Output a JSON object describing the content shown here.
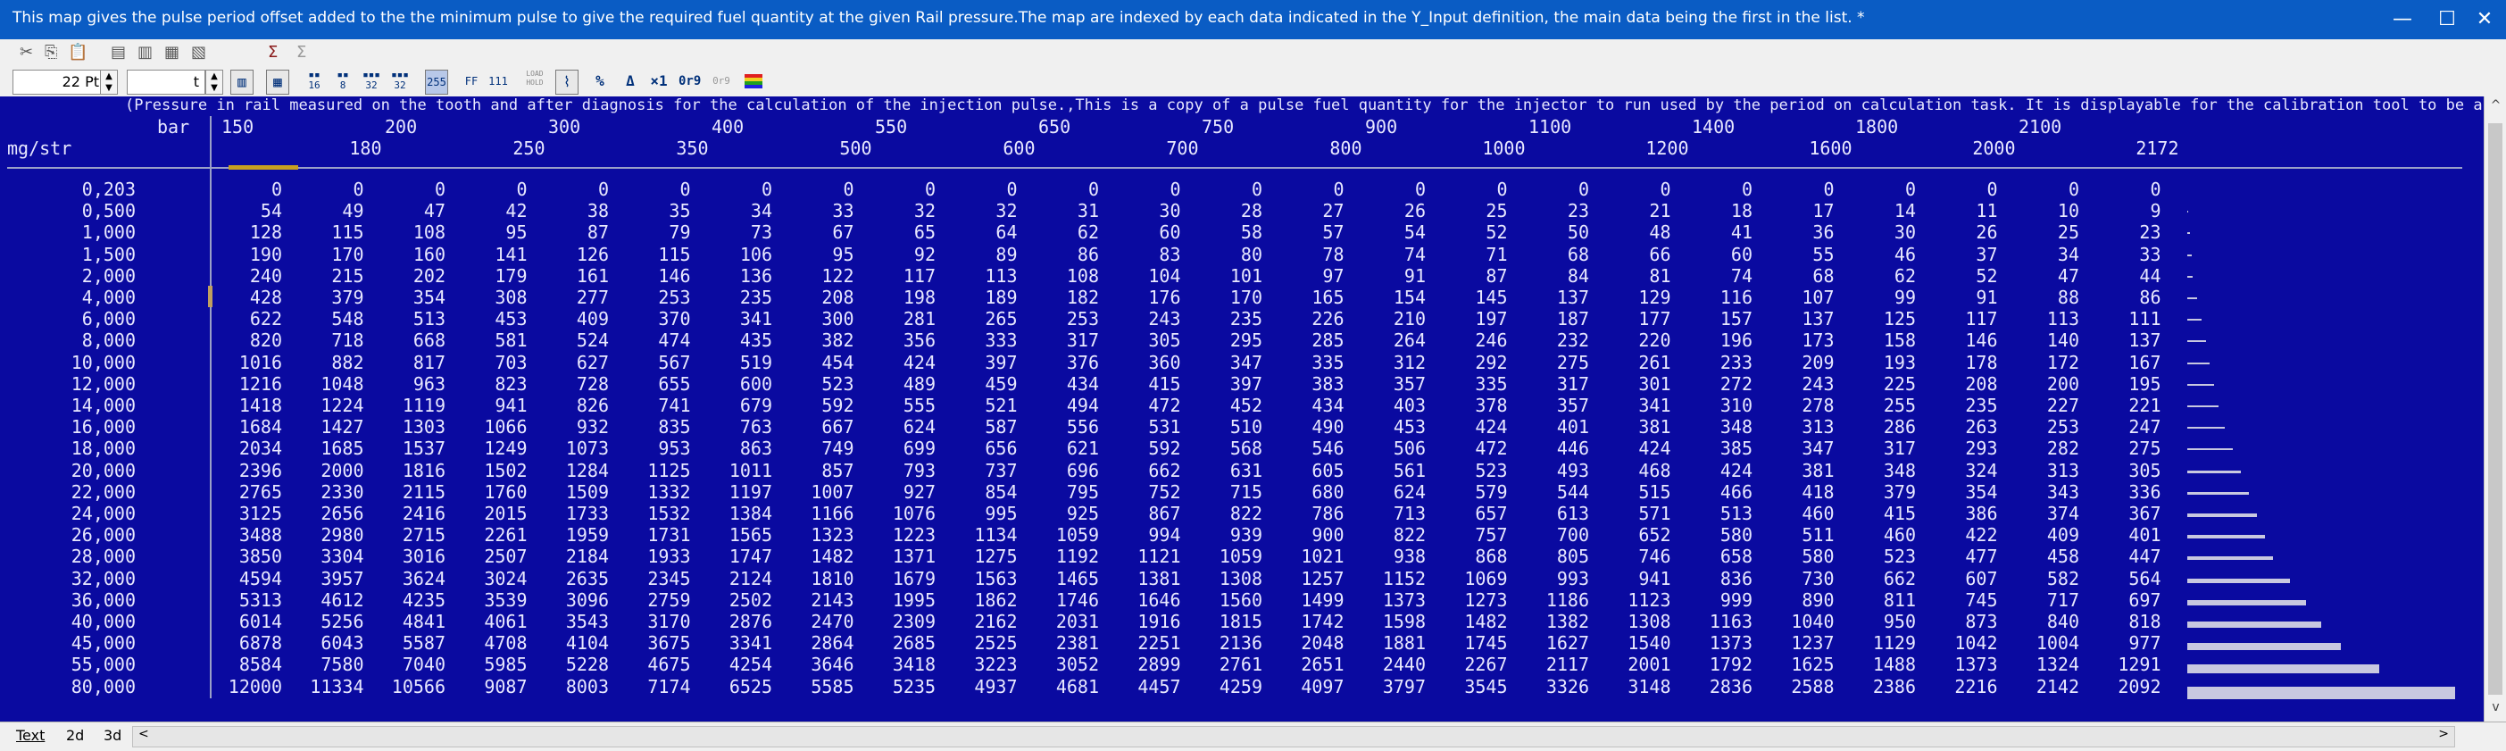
{
  "window": {
    "title": "This map gives the pulse period offset added to the the minimum pulse to give the required fuel quantity at the given Rail pressure.The map are indexed by each data indicated in the Y_Input definition, the main data being the first in the list. *",
    "minimize": "—",
    "maximize": "☐",
    "close": "✕"
  },
  "toolbar": {
    "font_size": "22 Pt",
    "t_field": "t"
  },
  "toolbar2_labels": {
    "btn_16": "16",
    "btn_32": "32",
    "btn_8_1": "8",
    "btn_32_2": "32",
    "btn_255": "255",
    "btn_FF": "FF",
    "btn_111": "111",
    "btn_Load": "LOAD HOLD",
    "btn_pct": "%",
    "btn_delta": "Δ",
    "btn_x1": "×1",
    "btn_0r9": "0r9",
    "btn_0r9b": "0r9"
  },
  "map": {
    "description": "(Pressure in rail measured on the tooth and after diagnosis for the calculation of the injection pulse.,This is a copy of a pulse fuel quantity for the injector to run used by the period on calculation task. It is displayable for the calibration tool to be able move current point when displaying different MAP.)/us",
    "x_unit": "bar",
    "y_unit": "mg/str",
    "x_axis": [
      "150",
      "180",
      "200",
      "250",
      "300",
      "350",
      "400",
      "500",
      "550",
      "600",
      "650",
      "700",
      "750",
      "800",
      "900",
      "1000",
      "1100",
      "1200",
      "1400",
      "1600",
      "1800",
      "2000",
      "2100",
      "2172"
    ],
    "y_axis": [
      "0,203",
      "0,500",
      "1,000",
      "1,500",
      "2,000",
      "4,000",
      "6,000",
      "8,000",
      "10,000",
      "12,000",
      "14,000",
      "16,000",
      "18,000",
      "20,000",
      "22,000",
      "24,000",
      "26,000",
      "28,000",
      "32,000",
      "36,000",
      "40,000",
      "45,000",
      "55,000",
      "80,000"
    ],
    "rows": [
      [
        "0",
        "0",
        "0",
        "0",
        "0",
        "0",
        "0",
        "0",
        "0",
        "0",
        "0",
        "0",
        "0",
        "0",
        "0",
        "0",
        "0",
        "0",
        "0",
        "0",
        "0",
        "0",
        "0",
        "0"
      ],
      [
        "54",
        "49",
        "47",
        "42",
        "38",
        "35",
        "34",
        "33",
        "32",
        "32",
        "31",
        "30",
        "28",
        "27",
        "26",
        "25",
        "23",
        "21",
        "18",
        "17",
        "14",
        "11",
        "10",
        "9"
      ],
      [
        "128",
        "115",
        "108",
        "95",
        "87",
        "79",
        "73",
        "67",
        "65",
        "64",
        "62",
        "60",
        "58",
        "57",
        "54",
        "52",
        "50",
        "48",
        "41",
        "36",
        "30",
        "26",
        "25",
        "23"
      ],
      [
        "190",
        "170",
        "160",
        "141",
        "126",
        "115",
        "106",
        "95",
        "92",
        "89",
        "86",
        "83",
        "80",
        "78",
        "74",
        "71",
        "68",
        "66",
        "60",
        "55",
        "46",
        "37",
        "34",
        "33"
      ],
      [
        "240",
        "215",
        "202",
        "179",
        "161",
        "146",
        "136",
        "122",
        "117",
        "113",
        "108",
        "104",
        "101",
        "97",
        "91",
        "87",
        "84",
        "81",
        "74",
        "68",
        "62",
        "52",
        "47",
        "44"
      ],
      [
        "428",
        "379",
        "354",
        "308",
        "277",
        "253",
        "235",
        "208",
        "198",
        "189",
        "182",
        "176",
        "170",
        "165",
        "154",
        "145",
        "137",
        "129",
        "116",
        "107",
        "99",
        "91",
        "88",
        "86"
      ],
      [
        "622",
        "548",
        "513",
        "453",
        "409",
        "370",
        "341",
        "300",
        "281",
        "265",
        "253",
        "243",
        "235",
        "226",
        "210",
        "197",
        "187",
        "177",
        "157",
        "137",
        "125",
        "117",
        "113",
        "111"
      ],
      [
        "820",
        "718",
        "668",
        "581",
        "524",
        "474",
        "435",
        "382",
        "356",
        "333",
        "317",
        "305",
        "295",
        "285",
        "264",
        "246",
        "232",
        "220",
        "196",
        "173",
        "158",
        "146",
        "140",
        "137"
      ],
      [
        "1016",
        "882",
        "817",
        "703",
        "627",
        "567",
        "519",
        "454",
        "424",
        "397",
        "376",
        "360",
        "347",
        "335",
        "312",
        "292",
        "275",
        "261",
        "233",
        "209",
        "193",
        "178",
        "172",
        "167"
      ],
      [
        "1216",
        "1048",
        "963",
        "823",
        "728",
        "655",
        "600",
        "523",
        "489",
        "459",
        "434",
        "415",
        "397",
        "383",
        "357",
        "335",
        "317",
        "301",
        "272",
        "243",
        "225",
        "208",
        "200",
        "195"
      ],
      [
        "1418",
        "1224",
        "1119",
        "941",
        "826",
        "741",
        "679",
        "592",
        "555",
        "521",
        "494",
        "472",
        "452",
        "434",
        "403",
        "378",
        "357",
        "341",
        "310",
        "278",
        "255",
        "235",
        "227",
        "221"
      ],
      [
        "1684",
        "1427",
        "1303",
        "1066",
        "932",
        "835",
        "763",
        "667",
        "624",
        "587",
        "556",
        "531",
        "510",
        "490",
        "453",
        "424",
        "401",
        "381",
        "348",
        "313",
        "286",
        "263",
        "253",
        "247"
      ],
      [
        "2034",
        "1685",
        "1537",
        "1249",
        "1073",
        "953",
        "863",
        "749",
        "699",
        "656",
        "621",
        "592",
        "568",
        "546",
        "506",
        "472",
        "446",
        "424",
        "385",
        "347",
        "317",
        "293",
        "282",
        "275"
      ],
      [
        "2396",
        "2000",
        "1816",
        "1502",
        "1284",
        "1125",
        "1011",
        "857",
        "793",
        "737",
        "696",
        "662",
        "631",
        "605",
        "561",
        "523",
        "493",
        "468",
        "424",
        "381",
        "348",
        "324",
        "313",
        "305"
      ],
      [
        "2765",
        "2330",
        "2115",
        "1760",
        "1509",
        "1332",
        "1197",
        "1007",
        "927",
        "854",
        "795",
        "752",
        "715",
        "680",
        "624",
        "579",
        "544",
        "515",
        "466",
        "418",
        "379",
        "354",
        "343",
        "336"
      ],
      [
        "3125",
        "2656",
        "2416",
        "2015",
        "1733",
        "1532",
        "1384",
        "1166",
        "1076",
        "995",
        "925",
        "867",
        "822",
        "786",
        "713",
        "657",
        "613",
        "571",
        "513",
        "460",
        "415",
        "386",
        "374",
        "367"
      ],
      [
        "3488",
        "2980",
        "2715",
        "2261",
        "1959",
        "1731",
        "1565",
        "1323",
        "1223",
        "1134",
        "1059",
        "994",
        "939",
        "900",
        "822",
        "757",
        "700",
        "652",
        "580",
        "511",
        "460",
        "422",
        "409",
        "401"
      ],
      [
        "3850",
        "3304",
        "3016",
        "2507",
        "2184",
        "1933",
        "1747",
        "1482",
        "1371",
        "1275",
        "1192",
        "1121",
        "1059",
        "1021",
        "938",
        "868",
        "805",
        "746",
        "658",
        "580",
        "523",
        "477",
        "458",
        "447"
      ],
      [
        "4594",
        "3957",
        "3624",
        "3024",
        "2635",
        "2345",
        "2124",
        "1810",
        "1679",
        "1563",
        "1465",
        "1381",
        "1308",
        "1257",
        "1152",
        "1069",
        "993",
        "941",
        "836",
        "730",
        "662",
        "607",
        "582",
        "564"
      ],
      [
        "5313",
        "4612",
        "4235",
        "3539",
        "3096",
        "2759",
        "2502",
        "2143",
        "1995",
        "1862",
        "1746",
        "1646",
        "1560",
        "1499",
        "1373",
        "1273",
        "1186",
        "1123",
        "999",
        "890",
        "811",
        "745",
        "717",
        "697"
      ],
      [
        "6014",
        "5256",
        "4841",
        "4061",
        "3543",
        "3170",
        "2876",
        "2470",
        "2309",
        "2162",
        "2031",
        "1916",
        "1815",
        "1742",
        "1598",
        "1482",
        "1382",
        "1308",
        "1163",
        "1040",
        "950",
        "873",
        "840",
        "818"
      ],
      [
        "6878",
        "6043",
        "5587",
        "4708",
        "4104",
        "3675",
        "3341",
        "2864",
        "2685",
        "2525",
        "2381",
        "2251",
        "2136",
        "2048",
        "1881",
        "1745",
        "1627",
        "1540",
        "1373",
        "1237",
        "1129",
        "1042",
        "1004",
        "977"
      ],
      [
        "8584",
        "7580",
        "7040",
        "5985",
        "5228",
        "4675",
        "4254",
        "3646",
        "3418",
        "3223",
        "3052",
        "2899",
        "2761",
        "2651",
        "2440",
        "2267",
        "2117",
        "2001",
        "1792",
        "1625",
        "1488",
        "1373",
        "1324",
        "1291"
      ],
      [
        "12000",
        "11334",
        "10566",
        "9087",
        "8003",
        "7174",
        "6525",
        "5585",
        "5235",
        "4937",
        "4681",
        "4457",
        "4259",
        "4097",
        "3797",
        "3545",
        "3326",
        "3148",
        "2836",
        "2588",
        "2386",
        "2216",
        "2142",
        "2092"
      ]
    ]
  },
  "tabs": [
    "Text",
    "2d",
    "3d"
  ],
  "scroll_left": "<",
  "scroll_right": ">",
  "scroll_up": "^",
  "scroll_down": "v"
}
